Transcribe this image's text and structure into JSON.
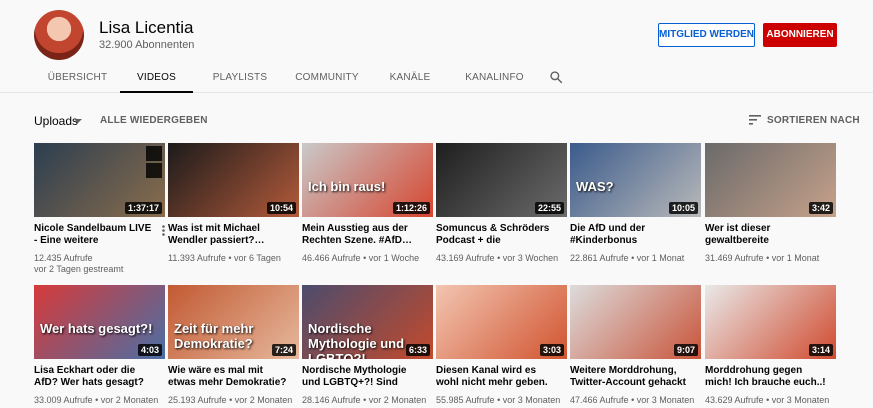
{
  "channel": {
    "name": "Lisa Licentia",
    "subscribers": "32.900 Abonnenten",
    "member_button": "MITGLIED WERDEN",
    "subscribe_button": "ABONNIEREN"
  },
  "tabs": [
    "ÜBERSICHT",
    "VIDEOS",
    "PLAYLISTS",
    "COMMUNITY",
    "KANÄLE",
    "KANALINFO"
  ],
  "active_tab": "VIDEOS",
  "toolbar": {
    "uploads_label": "Uploads",
    "play_all": "ALLE WIEDERGEBEN",
    "sort_label": "SORTIEREN NACH"
  },
  "videos": [
    {
      "title": "Nicole Sandelbaum LIVE - Eine weitere Aussteigerin…",
      "views": "12.435 Aufrufe",
      "age": "vor 2 Tagen gestreamt",
      "duration": "1:37:17",
      "thumb_text": "",
      "colors": [
        "#2c3e50",
        "#8a6d4c"
      ]
    },
    {
      "title": "Was ist mit Michael Wendler passiert?…",
      "views": "11.393 Aufrufe",
      "age": "vor 6 Tagen",
      "duration": "10:54",
      "thumb_text": "",
      "colors": [
        "#1b1b1b",
        "#b45a3a"
      ]
    },
    {
      "title": "Mein Ausstieg aus der Rechten Szene. #AfD…",
      "views": "46.466 Aufrufe",
      "age": "vor 1 Woche",
      "duration": "1:12:26",
      "thumb_text": "Ich bin raus!",
      "colors": [
        "#c9c9c9",
        "#d6452f"
      ]
    },
    {
      "title": "Somuncus & Schröders Podcast + die lächerliche…",
      "views": "43.169 Aufrufe",
      "age": "vor 3 Wochen",
      "duration": "22:55",
      "thumb_text": "",
      "colors": [
        "#1e1e1e",
        "#6b6b6b"
      ]
    },
    {
      "title": "Die AfD und der #Kinderbonus",
      "views": "22.861 Aufrufe",
      "age": "vor 1 Monat",
      "duration": "10:05",
      "thumb_text": "WAS?",
      "colors": [
        "#3b5b8c",
        "#b9b9b9"
      ]
    },
    {
      "title": "Wer ist dieser gewaltbereite Rechtsextreme? Wir wissen…",
      "views": "31.469 Aufrufe",
      "age": "vor 1 Monat",
      "duration": "3:42",
      "thumb_text": "",
      "colors": [
        "#6a6a6a",
        "#c7a18a"
      ]
    },
    {
      "title": "Lisa Eckhart oder die AfD? Wer hats gesagt?",
      "views": "33.009 Aufrufe",
      "age": "vor 2 Monaten",
      "duration": "4:03",
      "thumb_text": "Wer hats gesagt?!",
      "colors": [
        "#d63a3a",
        "#4a6fa5"
      ]
    },
    {
      "title": "Wie wäre es mal mit etwas mehr Demokratie?",
      "views": "25.193 Aufrufe",
      "age": "vor 2 Monaten",
      "duration": "7:24",
      "thumb_text": "Zeit für mehr Demokratie?",
      "colors": [
        "#c25a33",
        "#e6b89c"
      ]
    },
    {
      "title": "Nordische Mythologie und LGBTQ+?! Sind die…",
      "views": "28.146 Aufrufe",
      "age": "vor 2 Monaten",
      "duration": "6:33",
      "thumb_text": "Nordische Mythologie und LGBTQ?!",
      "colors": [
        "#4c4c6d",
        "#c44a2c"
      ]
    },
    {
      "title": "Diesen Kanal wird es wohl nicht mehr geben.",
      "views": "55.985 Aufrufe",
      "age": "vor 3 Monaten",
      "duration": "3:03",
      "thumb_text": "",
      "colors": [
        "#f2c5b1",
        "#d1542f"
      ]
    },
    {
      "title": "Weitere Morddrohung, Twitter-Account gehackt un…",
      "views": "47.466 Aufrufe",
      "age": "vor 3 Monaten",
      "duration": "9:07",
      "thumb_text": "",
      "colors": [
        "#dcdcdc",
        "#c9543a"
      ]
    },
    {
      "title": "Morddrohung gegen mich! Ich brauche euch..!",
      "views": "43.629 Aufrufe",
      "age": "vor 3 Monaten",
      "duration": "3:14",
      "thumb_text": "",
      "colors": [
        "#e9e9e9",
        "#d04a2e"
      ]
    }
  ]
}
